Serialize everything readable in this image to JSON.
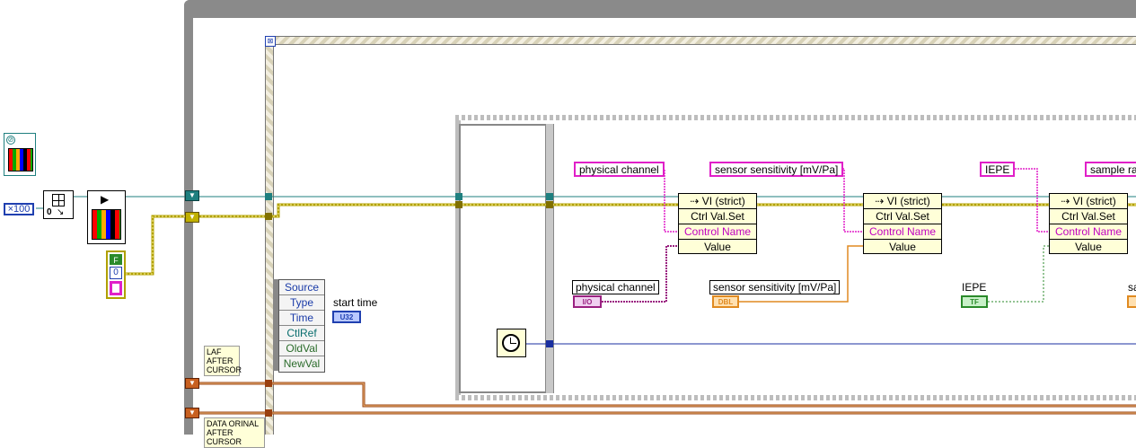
{
  "event_structure": {
    "event_data_items": [
      "Source",
      "Type",
      "Time",
      "CtlRef",
      "OldVal",
      "NewVal"
    ],
    "start_time_label": "start time",
    "start_time_terminal": "U32"
  },
  "constants": {
    "multiplier": "×100",
    "zero": "0",
    "bool_false": "F",
    "numeric_zero": "0"
  },
  "shift_labels": {
    "laf": "LAF AFTER CURSOR",
    "data_orinal": "DATA ORINAL AFTER CURSOR"
  },
  "string_constants": [
    "physical channel",
    "sensor sensitivity [mV/Pa]",
    "IEPE",
    "sample ra"
  ],
  "property_nodes": [
    {
      "head": "VI (strict)",
      "method": "Ctrl Val.Set",
      "param1": "Control Name",
      "param2": "Value"
    },
    {
      "head": "VI (strict)",
      "method": "Ctrl Val.Set",
      "param1": "Control Name",
      "param2": "Value"
    },
    {
      "head": "VI (strict)",
      "method": "Ctrl Val.Set",
      "param1": "Control Name",
      "param2": "Value"
    }
  ],
  "controls": [
    {
      "label": "physical channel",
      "terminal": "I/O"
    },
    {
      "label": "sensor sensitivity [mV/Pa]",
      "terminal": "DBL"
    },
    {
      "label": "IEPE",
      "terminal": "TF"
    },
    {
      "label": "sa",
      "terminal": ""
    }
  ],
  "colors": {
    "frame_gray": "#7a7a7a",
    "wire_teal": "#1f7f7f",
    "wire_yellow": "#b0a000",
    "wire_pink": "#e020c8",
    "wire_orange": "#e08a20",
    "wire_green": "#2a8a2a",
    "wire_blue": "#1a2fa0",
    "wire_brown": "#9a4010"
  },
  "icons": [
    "timer-icon",
    "vi-icon",
    "bundle-icon",
    "stop-icon"
  ]
}
